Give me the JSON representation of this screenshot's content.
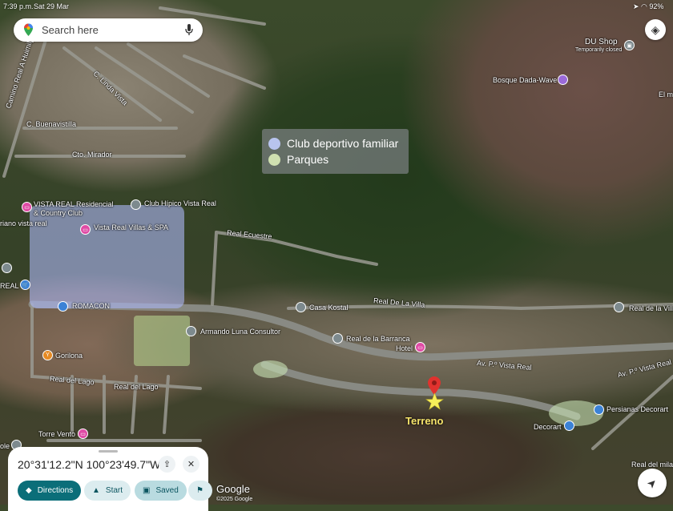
{
  "status_bar": {
    "time": "7:39 p.m.",
    "date": "Sat 29 Mar",
    "battery": "92%"
  },
  "search": {
    "placeholder": "Search here"
  },
  "legend": {
    "items": [
      {
        "label": "Club deportivo familiar",
        "color": "#b8c4ee"
      },
      {
        "label": "Parques",
        "color": "#cfe0b0"
      }
    ]
  },
  "streets": {
    "camino": "Camino Real A Huimilpan",
    "linda": "C. Linda Vista",
    "buenavistilla": "C. Buenavistilla",
    "mirador": "Cto. Mirador",
    "ecuestre": "Real Ecuestre",
    "villa1": "Real De La Villa",
    "villa2": "Real de la Villa",
    "lago1": "Real del Lago",
    "lago2": "Real del Lago",
    "vista1": "Av. P.º Vista Real",
    "vista2": "Av. P.º Vista Real",
    "milagro": "Real del milagro",
    "el_mi": "El mi",
    "mano": "riano vista real",
    "real": "REAL",
    "ole": "ole"
  },
  "places": {
    "du_shop": "DU Shop",
    "du_shop_status": "Temporarily closed",
    "bosque": "Bosque Dada-Wave",
    "vista_res": "VISTA REAL Residencial",
    "country": "& Country Club",
    "hipico": "Club Hípico Vista Real",
    "villas": "Vista Real Villas & SPA",
    "romacon": "ROMACON",
    "casa_kostal": "Casa Kostal",
    "armando": "Armando Luna Consultor",
    "barranca": "Real de la Barranca",
    "hotel": "Hotel",
    "gorilona": "Gorilona",
    "torre": "Torre Vento",
    "persianas": "Persianas Decorart",
    "decorart": "Decorart"
  },
  "pin": {
    "label": "Terreno"
  },
  "sheet": {
    "coords": "20°31'12.2\"N 100°23'49.7\"W",
    "directions": "Directions",
    "start": "Start",
    "saved": "Saved"
  },
  "attribution": {
    "brand": "Google",
    "copyright": "©2025 Google"
  }
}
